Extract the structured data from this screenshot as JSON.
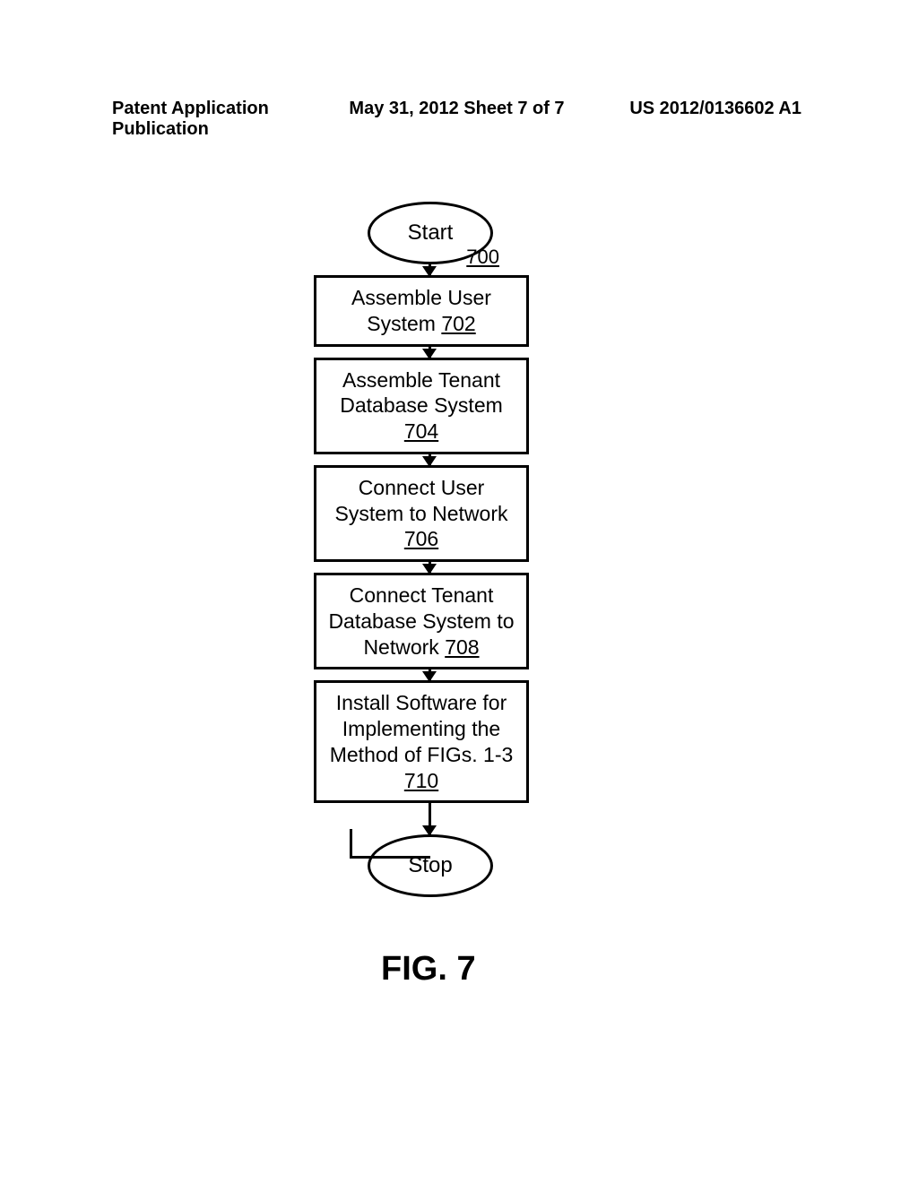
{
  "header": {
    "left": "Patent Application Publication",
    "center": "May 31, 2012  Sheet 7 of 7",
    "right": "US 2012/0136602 A1"
  },
  "flowchart": {
    "start": {
      "label": "Start",
      "id": "700"
    },
    "steps": [
      {
        "text_pre": "Assemble User System ",
        "id": "702"
      },
      {
        "text_pre": "Assemble Tenant Database System ",
        "id": "704"
      },
      {
        "text_pre": "Connect User System to Network ",
        "id": "706"
      },
      {
        "text_pre": "Connect Tenant Database System to Network ",
        "id": "708"
      },
      {
        "text_pre": "Install Software for Implementing the Method of FIGs. 1-3 ",
        "id": "710"
      }
    ],
    "stop": {
      "label": "Stop"
    }
  },
  "figure_label": "FIG. 7"
}
